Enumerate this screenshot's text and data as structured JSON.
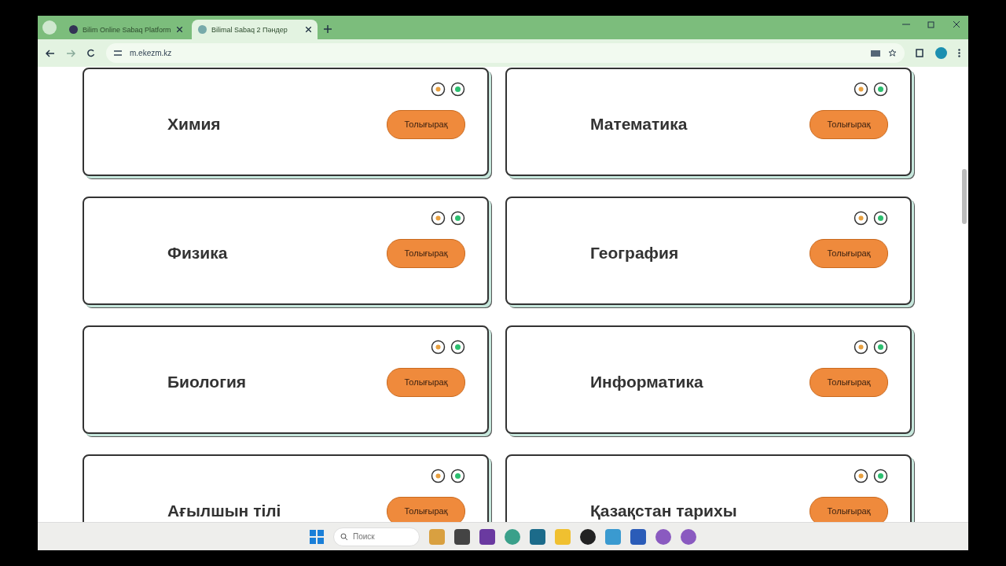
{
  "browser": {
    "tabs": [
      {
        "title": "Bilim Online Sabaq Platform",
        "selected": false
      },
      {
        "title": "Bilimal Sabaq 2 Пәндер",
        "selected": true
      }
    ],
    "url": "m.ekezm.kz"
  },
  "cards": [
    {
      "title": "Химия",
      "button": "Толығырақ"
    },
    {
      "title": "Математика",
      "button": "Толығырақ"
    },
    {
      "title": "Физика",
      "button": "Толығырақ"
    },
    {
      "title": "География",
      "button": "Толығырақ"
    },
    {
      "title": "Биология",
      "button": "Толығырақ"
    },
    {
      "title": "Информатика",
      "button": "Толығырақ"
    },
    {
      "title": "Ағылшын тілі",
      "button": "Толығырақ"
    },
    {
      "title": "Қазақстан тарихы",
      "button": "Толығырақ"
    }
  ],
  "taskbar": {
    "search": {
      "placeholder": "Поиск"
    }
  }
}
